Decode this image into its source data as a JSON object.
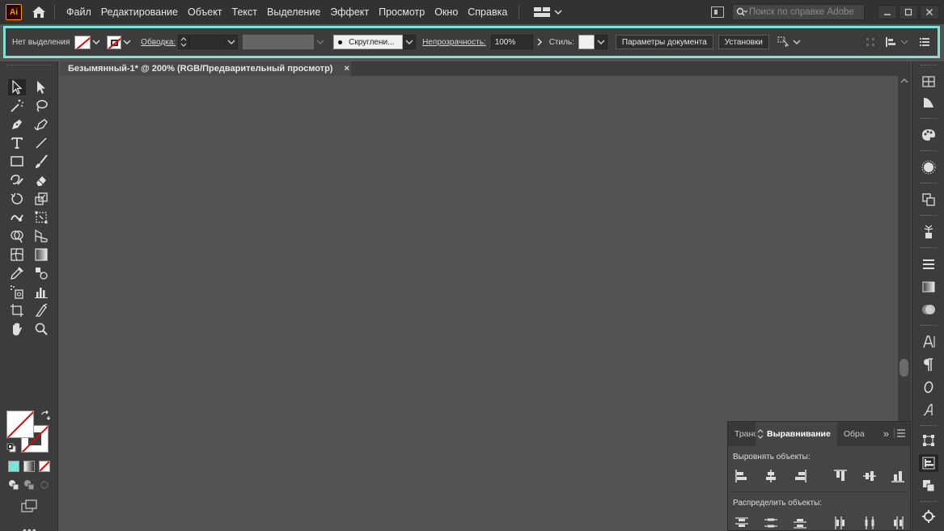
{
  "app": {
    "logo_text": "Ai",
    "menu": [
      "Файл",
      "Редактирование",
      "Объект",
      "Текст",
      "Выделение",
      "Эффект",
      "Просмотр",
      "Окно",
      "Справка"
    ],
    "help_search_placeholder": "Поиск по справке Adobe"
  },
  "control_bar": {
    "selection_label": "Нет выделения",
    "stroke_label": "Обводка:",
    "brush_label": "Скруглени...",
    "opacity_label": "Непрозрачность:",
    "opacity_value": "100%",
    "style_label": "Стиль:",
    "doc_setup_button": "Параметры документа",
    "preferences_button": "Установки"
  },
  "document": {
    "tab_title": "Безымянный-1* @ 200% (RGB/Предварительный просмотр)",
    "close_glyph": "×"
  },
  "align_panel": {
    "tabs": [
      "Транс",
      "Выравнивание",
      "Обра"
    ],
    "align_objects_label": "Выровнять объекты:",
    "distribute_objects_label": "Распределить объекты:",
    "expand_glyph": "»"
  },
  "colors": {
    "accent_highlight": "#7de3d6",
    "ui_dark": "#323232",
    "ui_panel": "#3c3c3c",
    "canvas": "#535353"
  }
}
